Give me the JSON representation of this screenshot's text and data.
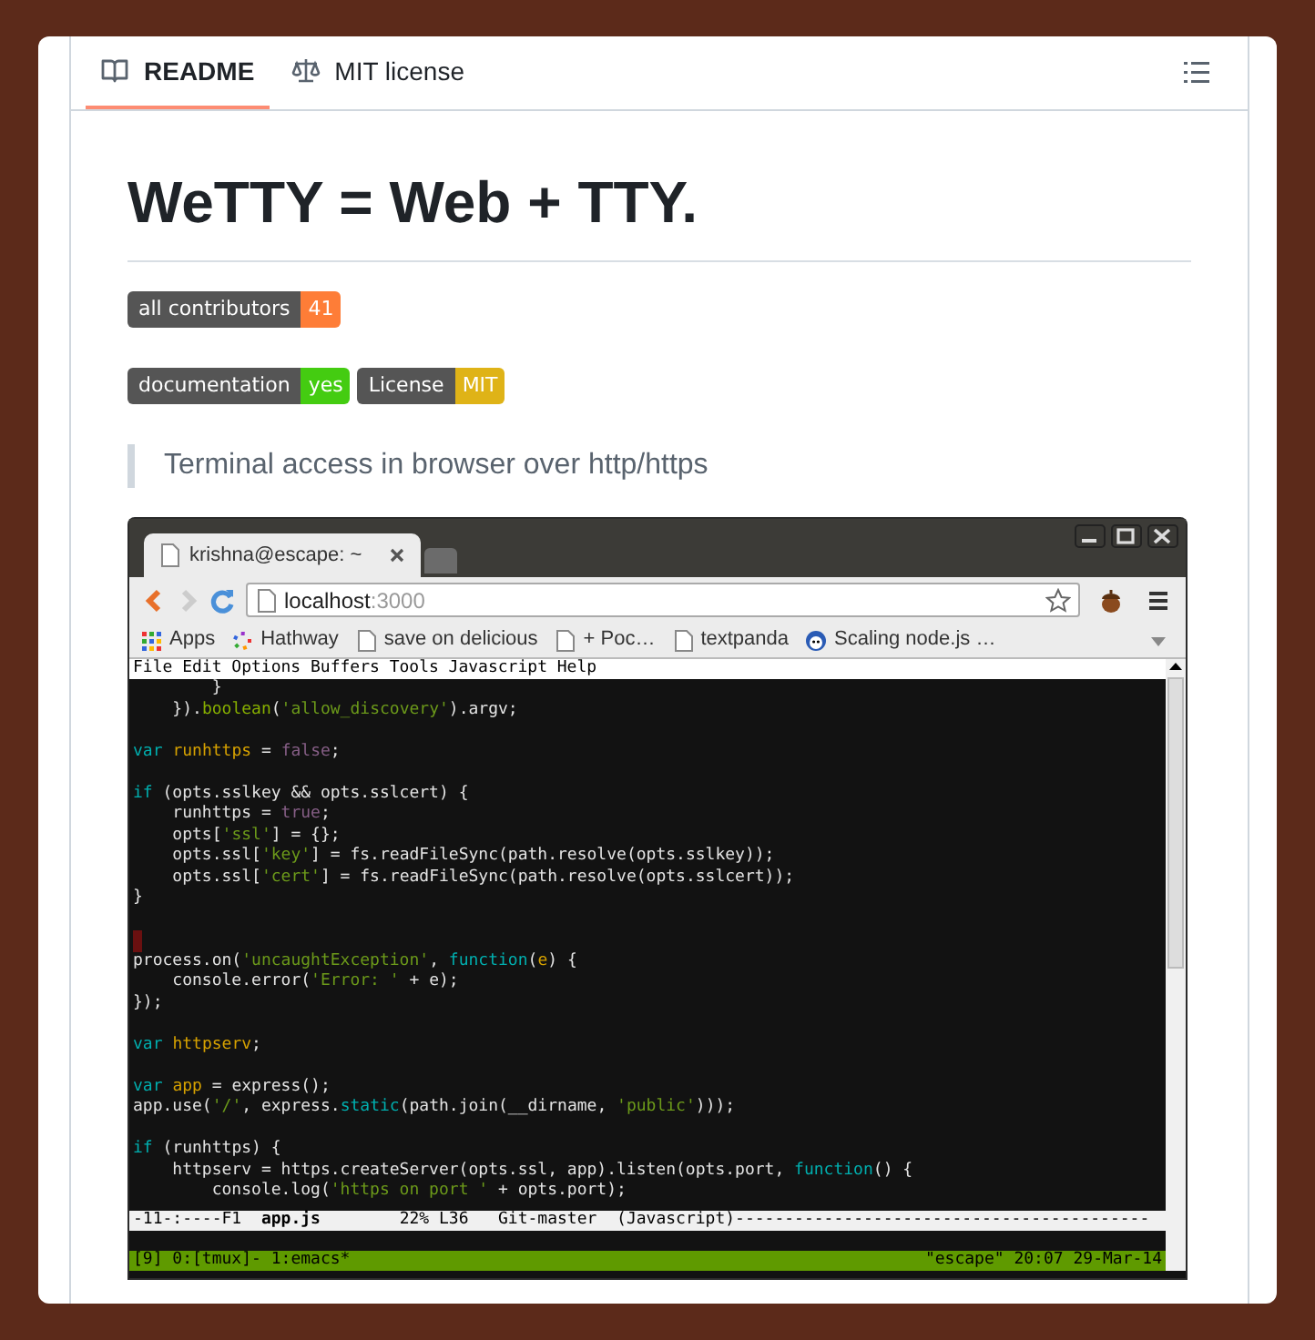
{
  "tabs": [
    {
      "label": "README",
      "kind": "book",
      "selected": true
    },
    {
      "label": "MIT license",
      "kind": "scale",
      "selected": false
    }
  ],
  "title": "WeTTY = Web + TTY.",
  "badge_rows": [
    [
      {
        "label": "all contributors",
        "value": "41",
        "color": "#fe7d37"
      }
    ],
    [
      {
        "label": "documentation",
        "value": "yes",
        "color": "#4c1"
      },
      {
        "label": "License",
        "value": "MIT",
        "color": "#dfb317"
      }
    ]
  ],
  "blockquote": "Terminal access in browser over http/https",
  "screenshot": {
    "tab_title": "krishna@escape: ~",
    "url_host": "localhost",
    "url_port": ":3000",
    "bookmarks": [
      {
        "label": "Apps",
        "kind": "apps"
      },
      {
        "label": "Hathway",
        "kind": "spinner"
      },
      {
        "label": "save on delicious",
        "kind": "page"
      },
      {
        "label": "+ Poc…",
        "kind": "page"
      },
      {
        "label": "textpanda",
        "kind": "page"
      },
      {
        "label": "Scaling node.js …",
        "kind": "mascot"
      }
    ],
    "menu_bar": [
      "File",
      "Edit",
      "Options",
      "Buffers",
      "Tools",
      "Javascript",
      "Help"
    ],
    "code_lines": [
      {
        "kind": "code",
        "segments": [
          {
            "kind": "plain",
            "text": "        }"
          }
        ]
      },
      {
        "kind": "code",
        "segments": [
          {
            "kind": "plain",
            "text": "    })."
          },
          {
            "kind": "method",
            "text": "boolean"
          },
          {
            "kind": "plain",
            "text": "("
          },
          {
            "kind": "str",
            "text": "'allow_discovery'"
          },
          {
            "kind": "plain",
            "text": ").argv;"
          }
        ]
      },
      {
        "kind": "blank"
      },
      {
        "kind": "code",
        "segments": [
          {
            "kind": "kw",
            "text": "var "
          },
          {
            "kind": "var",
            "text": "runhttps"
          },
          {
            "kind": "plain",
            "text": " = "
          },
          {
            "kind": "const",
            "text": "false"
          },
          {
            "kind": "plain",
            "text": ";"
          }
        ]
      },
      {
        "kind": "blank"
      },
      {
        "kind": "code",
        "segments": [
          {
            "kind": "kw",
            "text": "if"
          },
          {
            "kind": "plain",
            "text": " (opts.sslkey && opts.sslcert) {"
          }
        ]
      },
      {
        "kind": "code",
        "segments": [
          {
            "kind": "plain",
            "text": "    runhttps = "
          },
          {
            "kind": "const",
            "text": "true"
          },
          {
            "kind": "plain",
            "text": ";"
          }
        ]
      },
      {
        "kind": "code",
        "segments": [
          {
            "kind": "plain",
            "text": "    opts["
          },
          {
            "kind": "str",
            "text": "'ssl'"
          },
          {
            "kind": "plain",
            "text": "] = {};"
          }
        ]
      },
      {
        "kind": "code",
        "segments": [
          {
            "kind": "plain",
            "text": "    opts.ssl["
          },
          {
            "kind": "str",
            "text": "'key'"
          },
          {
            "kind": "plain",
            "text": "] = fs.readFileSync(path.resolve(opts.sslkey));"
          }
        ]
      },
      {
        "kind": "code",
        "segments": [
          {
            "kind": "plain",
            "text": "    opts.ssl["
          },
          {
            "kind": "str",
            "text": "'cert'"
          },
          {
            "kind": "plain",
            "text": "] = fs.readFileSync(path.resolve(opts.sslcert));"
          }
        ]
      },
      {
        "kind": "code",
        "segments": [
          {
            "kind": "plain",
            "text": "}"
          }
        ]
      },
      {
        "kind": "blank"
      },
      {
        "kind": "cursor"
      },
      {
        "kind": "code",
        "segments": [
          {
            "kind": "plain",
            "text": "process.on("
          },
          {
            "kind": "str",
            "text": "'uncaughtException'"
          },
          {
            "kind": "plain",
            "text": ", "
          },
          {
            "kind": "kw",
            "text": "function"
          },
          {
            "kind": "plain",
            "text": "("
          },
          {
            "kind": "var",
            "text": "e"
          },
          {
            "kind": "plain",
            "text": ") {"
          }
        ]
      },
      {
        "kind": "code",
        "segments": [
          {
            "kind": "plain",
            "text": "    console.error("
          },
          {
            "kind": "str",
            "text": "'Error: '"
          },
          {
            "kind": "plain",
            "text": " + e);"
          }
        ]
      },
      {
        "kind": "code",
        "segments": [
          {
            "kind": "plain",
            "text": "});"
          }
        ]
      },
      {
        "kind": "blank"
      },
      {
        "kind": "code",
        "segments": [
          {
            "kind": "kw",
            "text": "var "
          },
          {
            "kind": "var",
            "text": "httpserv"
          },
          {
            "kind": "plain",
            "text": ";"
          }
        ]
      },
      {
        "kind": "blank"
      },
      {
        "kind": "code",
        "segments": [
          {
            "kind": "kw",
            "text": "var "
          },
          {
            "kind": "var",
            "text": "app"
          },
          {
            "kind": "plain",
            "text": " = express();"
          }
        ]
      },
      {
        "kind": "code",
        "segments": [
          {
            "kind": "plain",
            "text": "app.use("
          },
          {
            "kind": "str",
            "text": "'/'"
          },
          {
            "kind": "plain",
            "text": ", express."
          },
          {
            "kind": "kw",
            "text": "static"
          },
          {
            "kind": "plain",
            "text": "(path.join(__dirname, "
          },
          {
            "kind": "str",
            "text": "'public'"
          },
          {
            "kind": "plain",
            "text": ")));"
          }
        ]
      },
      {
        "kind": "blank"
      },
      {
        "kind": "code",
        "segments": [
          {
            "kind": "kw",
            "text": "if"
          },
          {
            "kind": "plain",
            "text": " (runhttps) {"
          }
        ]
      },
      {
        "kind": "code",
        "segments": [
          {
            "kind": "plain",
            "text": "    httpserv = https.createServer(opts.ssl, app).listen(opts.port, "
          },
          {
            "kind": "kw",
            "text": "function"
          },
          {
            "kind": "plain",
            "text": "() {"
          }
        ]
      },
      {
        "kind": "code",
        "segments": [
          {
            "kind": "plain",
            "text": "        console.log("
          },
          {
            "kind": "str",
            "text": "'https on port '"
          },
          {
            "kind": "plain",
            "text": " + opts.port);"
          }
        ]
      }
    ],
    "mode_line": "-11-:----F1  **app.js**        22% L36   Git-master  (Javascript)------------------------------------------",
    "status_left": "[9] 0:[tmux]- 1:emacs*",
    "status_right": "\"escape\" 20:07 29-Mar-14"
  }
}
